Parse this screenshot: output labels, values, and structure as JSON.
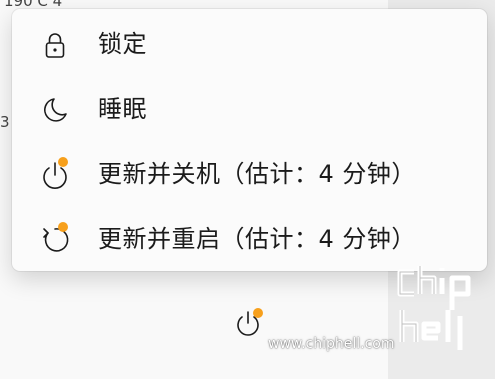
{
  "background": {
    "snippet_top": "190 C    4",
    "snippet_mid": "3"
  },
  "menu": {
    "items": [
      {
        "label": "锁定",
        "icon": "lock-icon"
      },
      {
        "label": "睡眠",
        "icon": "moon-icon"
      },
      {
        "label": "更新并关机（估计：4 分钟）",
        "icon": "power-update-icon",
        "has_update_badge": true
      },
      {
        "label": "更新并重启（估计：4 分钟）",
        "icon": "restart-update-icon",
        "has_update_badge": true
      }
    ]
  },
  "taskbar": {
    "power_icon": "power-update-icon"
  },
  "watermark": {
    "url": "www.chiphell.com",
    "logo_text": "chiphell"
  },
  "colors": {
    "menu_bg": "#fbfbfb",
    "text": "#1b1b1b",
    "update_badge": "#f7a01c",
    "page_bg": "#f3f3f3"
  }
}
